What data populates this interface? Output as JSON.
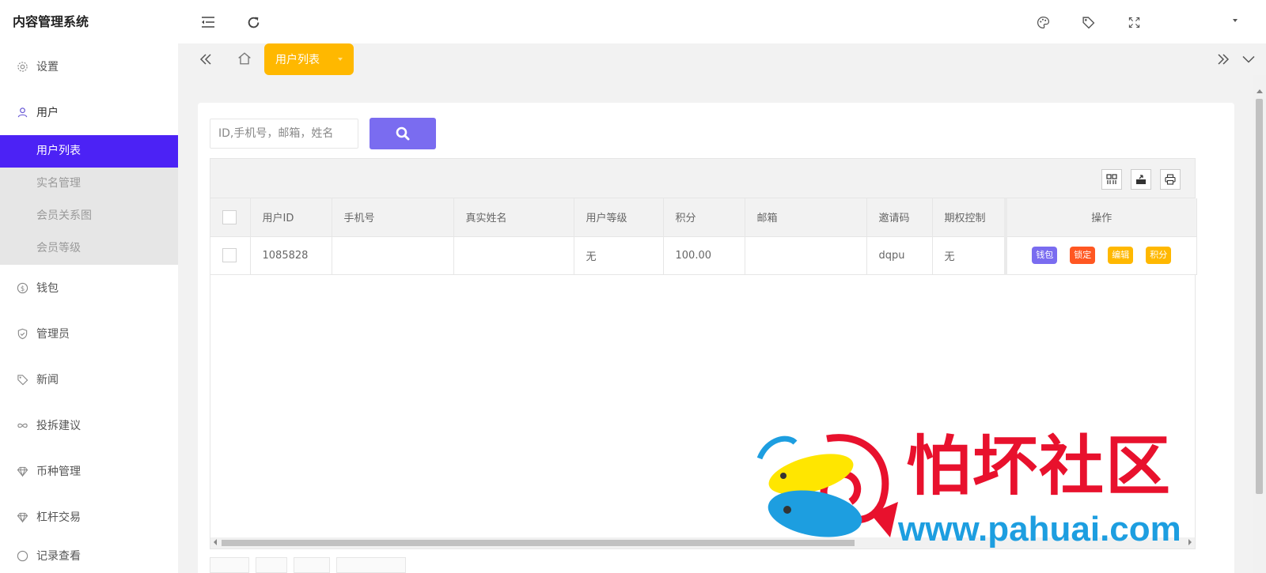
{
  "app": {
    "title": "内容管理系统"
  },
  "sidebar": {
    "items": [
      {
        "label": "设置",
        "icon": "gear-icon"
      },
      {
        "label": "用户",
        "icon": "user-icon"
      },
      {
        "label": "钱包",
        "icon": "dollar-icon"
      },
      {
        "label": "管理员",
        "icon": "shield-icon"
      },
      {
        "label": "新闻",
        "icon": "tag-icon"
      },
      {
        "label": "投拆建议",
        "icon": "infinity-icon"
      },
      {
        "label": "币种管理",
        "icon": "diamond-icon"
      },
      {
        "label": "杠杆交易",
        "icon": "diamond-icon"
      },
      {
        "label": "记录查看",
        "icon": "list-icon"
      }
    ],
    "submenu": [
      {
        "label": "用户列表"
      },
      {
        "label": "实名管理"
      },
      {
        "label": "会员关系图"
      },
      {
        "label": "会员等级"
      }
    ]
  },
  "tabs": {
    "active": "用户列表"
  },
  "search": {
    "placeholder": "ID,手机号，邮箱，姓名",
    "value": ""
  },
  "table": {
    "columns": [
      "用户ID",
      "手机号",
      "真实姓名",
      "用户等级",
      "积分",
      "邮箱",
      "邀请码",
      "期权控制",
      "操作"
    ],
    "rows": [
      {
        "id": "1085828",
        "phone": "",
        "name": "",
        "level": "无",
        "points": "100.00",
        "email": "",
        "invite": "dqpu",
        "option_control": "无"
      }
    ],
    "actions": [
      {
        "label": "钱包",
        "color": "#7a6cf0"
      },
      {
        "label": "锁定",
        "color": "#ff5722"
      },
      {
        "label": "编辑",
        "color": "#ffb800"
      },
      {
        "label": "积分",
        "color": "#ffb800"
      }
    ]
  },
  "colors": {
    "accent": "#4c22f5",
    "tab_active": "#ffb800",
    "search_button": "#7a6cf0"
  },
  "watermark": {
    "title": "怕坏社区",
    "url": "www.pahuai.com"
  }
}
